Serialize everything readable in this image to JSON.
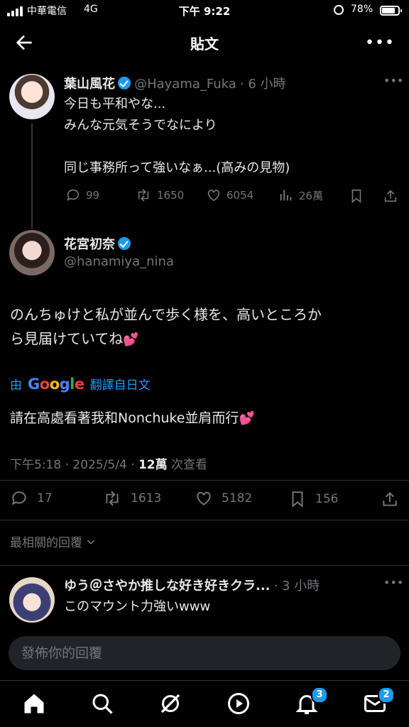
{
  "status_bar": {
    "carrier": "中華電信",
    "network": "4G",
    "time": "下午 9:22",
    "battery": "78%",
    "battery_level": 0.78
  },
  "header": {
    "title": "貼文"
  },
  "parent_tweet": {
    "name": "葉山風花",
    "handle": "@Hayama_Fuka",
    "time": "· 6 小時",
    "lines": [
      "今日も平和やな...",
      "みんな元気そうでなにより",
      "",
      "同じ事務所って強いなぁ...(高みの見物)"
    ],
    "replies": "99",
    "retweets": "1650",
    "likes": "6054",
    "views": "26萬"
  },
  "main_tweet": {
    "name": "花宮初奈",
    "handle": "@hanamiya_nina",
    "text_line1": "のんちゅけと私が並んで歩く様を、高いところか",
    "text_line2": "ら見届けていてね",
    "emoji": "💕",
    "translate_by": "由",
    "translate_brand": "Google",
    "translate_label": "翻譯自日文",
    "translation": "請在高處看著我和Nonchuke並肩而行",
    "timestamp": "下午5:18 · 2025/5/4 · ",
    "views_count": "12萬",
    "views_label": " 次查看",
    "replies": "17",
    "retweets": "1613",
    "likes": "5182",
    "bookmarks": "156"
  },
  "sort_label": "最相關的回覆",
  "reply_tweet": {
    "name": "ゆう＠さやか推しな好き好きクラ...",
    "time": "· 3 小時",
    "text": "このマウント力強いwww"
  },
  "reply_box": {
    "placeholder": "發佈你的回覆"
  },
  "tabs": {
    "notifications_badge": "3",
    "messages_badge": "2"
  },
  "colors": {
    "background": "#000000",
    "accent": "#1d9bf0",
    "muted": "#71767b",
    "text": "#e7e9ea"
  }
}
